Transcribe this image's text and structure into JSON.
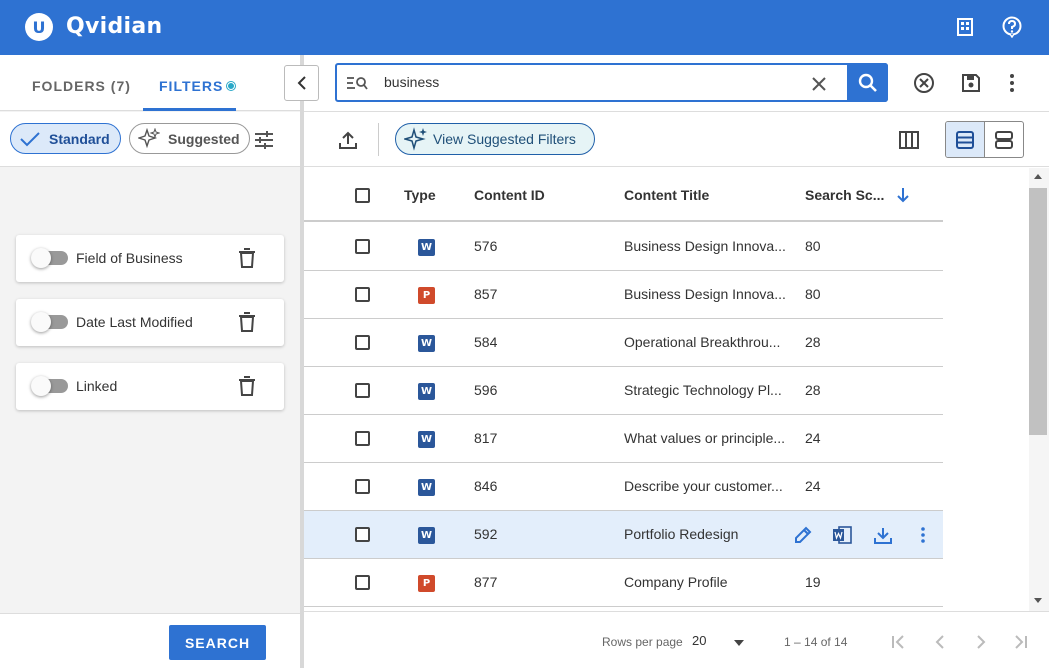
{
  "header": {
    "logo_letter": "U",
    "brand": "Qvidian"
  },
  "left_panel": {
    "tabs": [
      {
        "label": "FOLDERS (7)"
      },
      {
        "label": "FILTERS"
      }
    ],
    "chips": {
      "standard": "Standard",
      "suggested": "Suggested"
    },
    "filters": [
      {
        "label": "Field of Business"
      },
      {
        "label": "Date Last Modified"
      },
      {
        "label": "Linked"
      }
    ],
    "search_button": "SEARCH"
  },
  "search": {
    "query": "business"
  },
  "toolbar": {
    "view_suggested_filters": "View Suggested Filters"
  },
  "table": {
    "columns": {
      "type": "Type",
      "content_id": "Content ID",
      "content_title": "Content Title",
      "search_score": "Search Sc..."
    },
    "rows": [
      {
        "type": "word",
        "type_letter": "W",
        "content_id": "576",
        "title": "Business Design Innova...",
        "score": "80"
      },
      {
        "type": "ppt",
        "type_letter": "P",
        "content_id": "857",
        "title": "Business Design Innova...",
        "score": "80"
      },
      {
        "type": "word",
        "type_letter": "W",
        "content_id": "584",
        "title": "Operational Breakthrou...",
        "score": "28"
      },
      {
        "type": "word",
        "type_letter": "W",
        "content_id": "596",
        "title": "Strategic Technology Pl...",
        "score": "28"
      },
      {
        "type": "word",
        "type_letter": "W",
        "content_id": "817",
        "title": "What values or principle...",
        "score": "24"
      },
      {
        "type": "word",
        "type_letter": "W",
        "content_id": "846",
        "title": "Describe your customer...",
        "score": "24"
      },
      {
        "type": "word",
        "type_letter": "W",
        "content_id": "592",
        "title": "Portfolio Redesign",
        "score": ""
      },
      {
        "type": "ppt",
        "type_letter": "P",
        "content_id": "877",
        "title": "Company Profile",
        "score": "19"
      }
    ]
  },
  "pagination": {
    "rows_per_page_label": "Rows per page",
    "rows_per_page_value": "20",
    "range": "1 – 14 of 14"
  },
  "colors": {
    "primary": "#2e72d2",
    "word": "#2b579a",
    "ppt": "#d04a2b",
    "hover_row": "#e3eefb"
  }
}
